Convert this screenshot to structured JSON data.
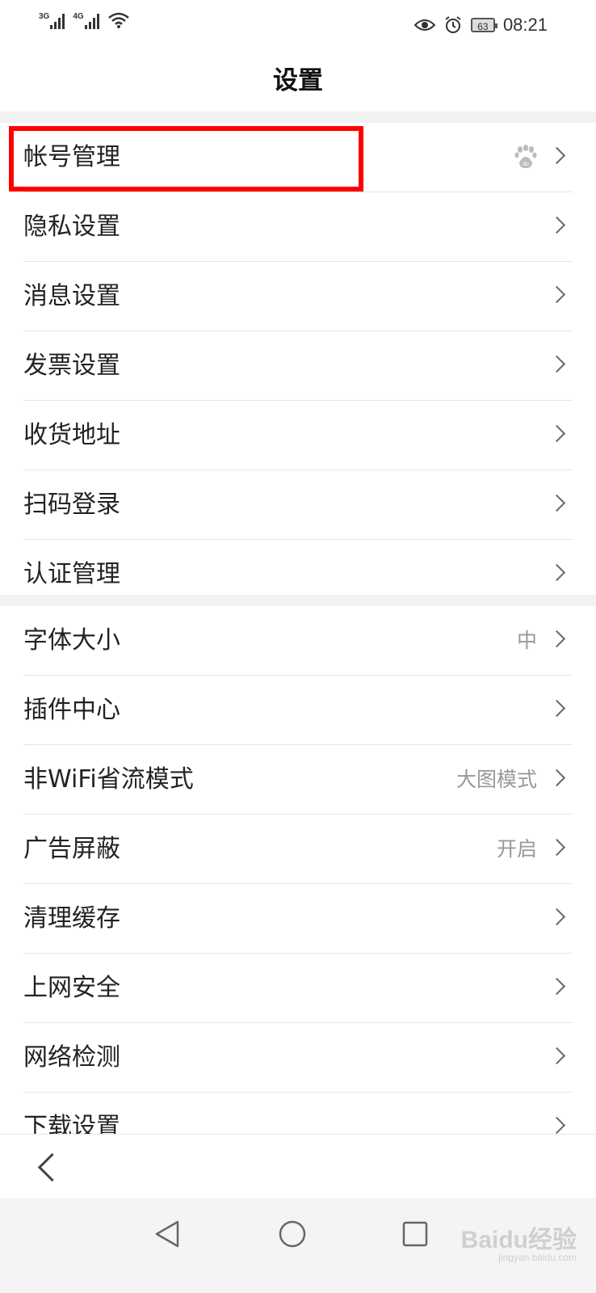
{
  "status_bar": {
    "net1": "3G",
    "net2": "4G",
    "battery": "63",
    "time": "08:21",
    "icons": [
      "signal-icon",
      "signal-icon",
      "wifi-icon",
      "eye-comfort-icon",
      "alarm-icon",
      "battery-icon"
    ]
  },
  "header": {
    "title": "设置"
  },
  "group1": {
    "items": [
      {
        "label": "帐号管理",
        "value": "",
        "icon": "baidu-paw-icon"
      },
      {
        "label": "隐私设置",
        "value": ""
      },
      {
        "label": "消息设置",
        "value": ""
      },
      {
        "label": "发票设置",
        "value": ""
      },
      {
        "label": "收货地址",
        "value": ""
      },
      {
        "label": "扫码登录",
        "value": ""
      },
      {
        "label": "认证管理",
        "value": ""
      }
    ]
  },
  "group2": {
    "items": [
      {
        "label": "字体大小",
        "value": "中"
      },
      {
        "label": "插件中心",
        "value": ""
      },
      {
        "label": "非WiFi省流模式",
        "value": "大图模式"
      },
      {
        "label": "广告屏蔽",
        "value": "开启"
      },
      {
        "label": "清理缓存",
        "value": ""
      },
      {
        "label": "上网安全",
        "value": ""
      },
      {
        "label": "网络检测",
        "value": ""
      },
      {
        "label": "下载设置",
        "value": ""
      }
    ]
  },
  "highlight_color": "#ff0000",
  "watermark": {
    "brand": "Baidu经验",
    "url": "jingyan.baidu.com"
  }
}
